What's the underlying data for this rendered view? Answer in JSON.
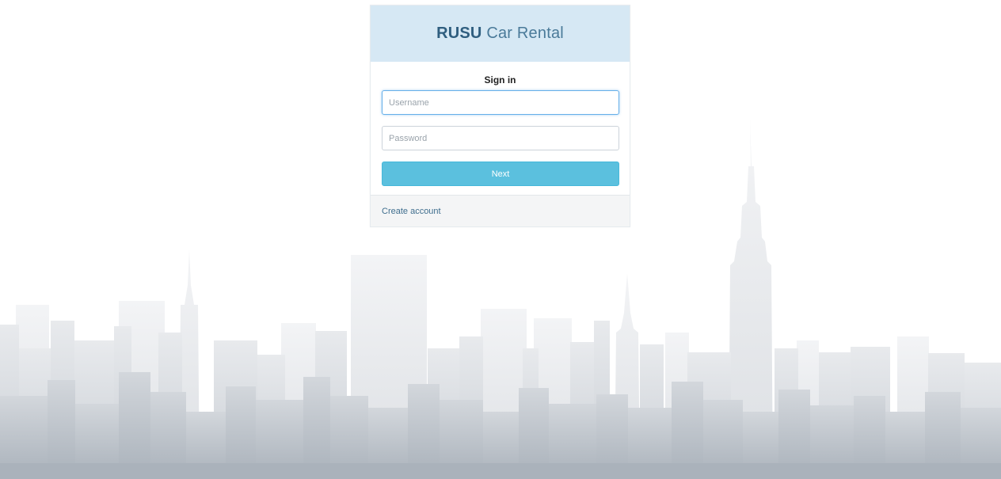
{
  "app": {
    "brand_strong": "RUSU",
    "brand_rest": " Car Rental"
  },
  "login": {
    "title": "Sign in",
    "username_placeholder": "Username",
    "password_placeholder": "Password",
    "next_label": "Next",
    "create_account_label": "Create account"
  },
  "colors": {
    "header_bg": "#d6e8f4",
    "button_bg": "#5bc0de",
    "skyline_far": "#eceef1",
    "skyline_mid": "#dfe2e6",
    "skyline_near": "#b9c0c8"
  }
}
